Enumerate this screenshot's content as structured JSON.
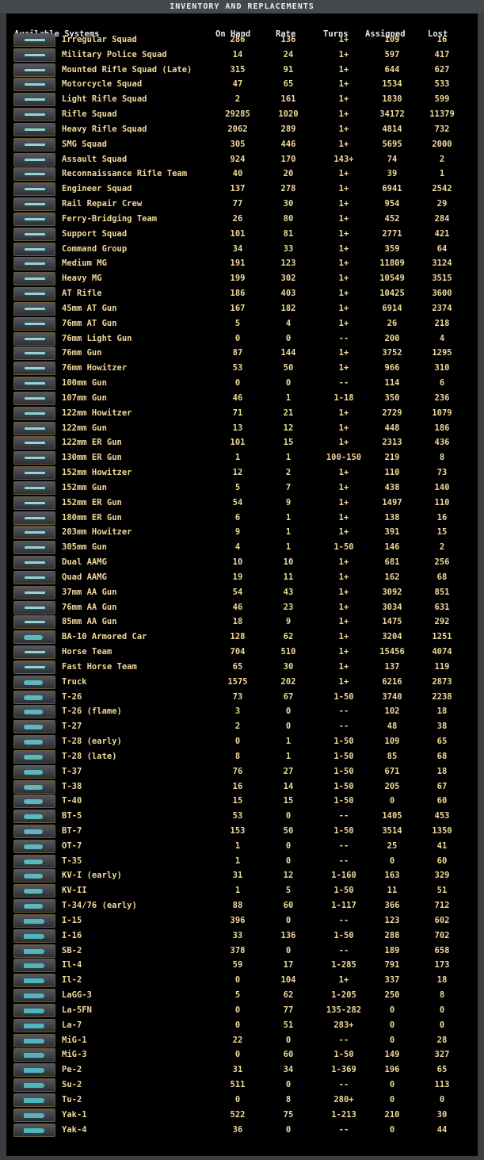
{
  "title": "INVENTORY AND REPLACEMENTS",
  "headers": {
    "name": "Available Systems",
    "on_hand": "On Hand",
    "rate": "Rate",
    "turns": "Turns",
    "assigned": "Assigned",
    "lost": "Lost"
  },
  "rows": [
    [
      "Irregular Squad",
      "286",
      "136",
      "1+",
      "109",
      "16",
      "rifle"
    ],
    [
      "Military Police Squad",
      "14",
      "24",
      "1+",
      "597",
      "417",
      "rifle"
    ],
    [
      "Mounted Rifle Squad (Late)",
      "315",
      "91",
      "1+",
      "644",
      "627",
      "rifle"
    ],
    [
      "Motorcycle Squad",
      "47",
      "65",
      "1+",
      "1534",
      "533",
      "rifle"
    ],
    [
      "Light Rifle Squad",
      "2",
      "161",
      "1+",
      "1830",
      "599",
      "rifle"
    ],
    [
      "Rifle Squad",
      "29285",
      "1020",
      "1+",
      "34172",
      "11379",
      "rifle"
    ],
    [
      "Heavy Rifle Squad",
      "2062",
      "289",
      "1+",
      "4814",
      "732",
      "rifle"
    ],
    [
      "SMG Squad",
      "305",
      "446",
      "1+",
      "5695",
      "2000",
      "rifle"
    ],
    [
      "Assault Squad",
      "924",
      "170",
      "143+",
      "74",
      "2",
      "rifle"
    ],
    [
      "Reconnaissance Rifle Team",
      "40",
      "20",
      "1+",
      "39",
      "1",
      "rifle"
    ],
    [
      "Engineer Squad",
      "137",
      "278",
      "1+",
      "6941",
      "2542",
      "rifle"
    ],
    [
      "Rail Repair Crew",
      "77",
      "30",
      "1+",
      "954",
      "29",
      "rifle"
    ],
    [
      "Ferry-Bridging Team",
      "26",
      "80",
      "1+",
      "452",
      "284",
      "rifle"
    ],
    [
      "Support Squad",
      "101",
      "81",
      "1+",
      "2771",
      "421",
      "rifle"
    ],
    [
      "Command Group",
      "34",
      "33",
      "1+",
      "359",
      "64",
      "rifle"
    ],
    [
      "Medium MG",
      "191",
      "123",
      "1+",
      "11809",
      "3124",
      "rifle"
    ],
    [
      "Heavy MG",
      "199",
      "302",
      "1+",
      "10549",
      "3515",
      "rifle"
    ],
    [
      "AT Rifle",
      "186",
      "403",
      "1+",
      "10425",
      "3600",
      "rifle"
    ],
    [
      "45mm AT Gun",
      "167",
      "182",
      "1+",
      "6914",
      "2374",
      "gun"
    ],
    [
      "76mm AT Gun",
      "5",
      "4",
      "1+",
      "26",
      "218",
      "gun"
    ],
    [
      "76mm Light Gun",
      "0",
      "0",
      "--",
      "200",
      "4",
      "gun"
    ],
    [
      "76mm Gun",
      "87",
      "144",
      "1+",
      "3752",
      "1295",
      "gun"
    ],
    [
      "76mm Howitzer",
      "53",
      "50",
      "1+",
      "966",
      "310",
      "gun"
    ],
    [
      "100mm Gun",
      "0",
      "0",
      "--",
      "114",
      "6",
      "gun"
    ],
    [
      "107mm Gun",
      "46",
      "1",
      "1-18",
      "350",
      "236",
      "gun"
    ],
    [
      "122mm Howitzer",
      "71",
      "21",
      "1+",
      "2729",
      "1079",
      "gun"
    ],
    [
      "122mm Gun",
      "13",
      "12",
      "1+",
      "448",
      "186",
      "gun"
    ],
    [
      "122mm ER Gun",
      "101",
      "15",
      "1+",
      "2313",
      "436",
      "gun"
    ],
    [
      "130mm ER Gun",
      "1",
      "1",
      "100-150",
      "219",
      "8",
      "gun"
    ],
    [
      "152mm Howitzer",
      "12",
      "2",
      "1+",
      "110",
      "73",
      "gun"
    ],
    [
      "152mm Gun",
      "5",
      "7",
      "1+",
      "438",
      "140",
      "gun"
    ],
    [
      "152mm ER Gun",
      "54",
      "9",
      "1+",
      "1497",
      "110",
      "gun"
    ],
    [
      "180mm ER Gun",
      "6",
      "1",
      "1+",
      "138",
      "16",
      "gun"
    ],
    [
      "203mm Howitzer",
      "9",
      "1",
      "1+",
      "391",
      "15",
      "gun"
    ],
    [
      "305mm Gun",
      "4",
      "1",
      "1-50",
      "146",
      "2",
      "gun"
    ],
    [
      "Dual AAMG",
      "10",
      "10",
      "1+",
      "681",
      "256",
      "gun"
    ],
    [
      "Quad AAMG",
      "19",
      "11",
      "1+",
      "162",
      "68",
      "gun"
    ],
    [
      "37mm AA Gun",
      "54",
      "43",
      "1+",
      "3092",
      "851",
      "gun"
    ],
    [
      "76mm AA Gun",
      "46",
      "23",
      "1+",
      "3034",
      "631",
      "gun"
    ],
    [
      "85mm AA Gun",
      "18",
      "9",
      "1+",
      "1475",
      "292",
      "gun"
    ],
    [
      "BA-10 Armored Car",
      "128",
      "62",
      "1+",
      "3204",
      "1251",
      "tank"
    ],
    [
      "Horse Team",
      "704",
      "510",
      "1+",
      "15456",
      "4074",
      "gun"
    ],
    [
      "Fast Horse Team",
      "65",
      "30",
      "1+",
      "137",
      "119",
      "gun"
    ],
    [
      "Truck",
      "1575",
      "202",
      "1+",
      "6216",
      "2873",
      "tank"
    ],
    [
      "T-26",
      "73",
      "67",
      "1-50",
      "3740",
      "2238",
      "tank"
    ],
    [
      "T-26 (flame)",
      "3",
      "0",
      "--",
      "102",
      "18",
      "tank"
    ],
    [
      "T-27",
      "2",
      "0",
      "--",
      "48",
      "38",
      "tank"
    ],
    [
      "T-28 (early)",
      "0",
      "1",
      "1-50",
      "109",
      "65",
      "tank"
    ],
    [
      "T-28 (late)",
      "8",
      "1",
      "1-50",
      "85",
      "68",
      "tank"
    ],
    [
      "T-37",
      "76",
      "27",
      "1-50",
      "671",
      "18",
      "tank"
    ],
    [
      "T-38",
      "16",
      "14",
      "1-50",
      "205",
      "67",
      "tank"
    ],
    [
      "T-40",
      "15",
      "15",
      "1-50",
      "0",
      "60",
      "tank"
    ],
    [
      "BT-5",
      "53",
      "0",
      "--",
      "1405",
      "453",
      "tank"
    ],
    [
      "BT-7",
      "153",
      "50",
      "1-50",
      "3514",
      "1350",
      "tank"
    ],
    [
      "OT-7",
      "1",
      "0",
      "--",
      "25",
      "41",
      "tank"
    ],
    [
      "T-35",
      "1",
      "0",
      "--",
      "0",
      "60",
      "tank"
    ],
    [
      "KV-I (early)",
      "31",
      "12",
      "1-160",
      "163",
      "329",
      "tank"
    ],
    [
      "KV-II",
      "1",
      "5",
      "1-50",
      "11",
      "51",
      "tank"
    ],
    [
      "T-34/76 (early)",
      "88",
      "60",
      "1-117",
      "366",
      "712",
      "tank"
    ],
    [
      "I-15",
      "396",
      "0",
      "--",
      "123",
      "602",
      "air"
    ],
    [
      "I-16",
      "33",
      "136",
      "1-50",
      "288",
      "702",
      "air"
    ],
    [
      "SB-2",
      "378",
      "0",
      "--",
      "189",
      "658",
      "air"
    ],
    [
      "Il-4",
      "59",
      "17",
      "1-285",
      "791",
      "173",
      "air"
    ],
    [
      "Il-2",
      "0",
      "104",
      "1+",
      "337",
      "18",
      "air"
    ],
    [
      "LaGG-3",
      "5",
      "62",
      "1-205",
      "250",
      "8",
      "air"
    ],
    [
      "La-5FN",
      "0",
      "77",
      "135-282",
      "0",
      "0",
      "air"
    ],
    [
      "La-7",
      "0",
      "51",
      "283+",
      "0",
      "0",
      "air"
    ],
    [
      "MiG-1",
      "22",
      "0",
      "--",
      "0",
      "28",
      "air"
    ],
    [
      "MiG-3",
      "0",
      "60",
      "1-50",
      "149",
      "327",
      "air"
    ],
    [
      "Pe-2",
      "31",
      "34",
      "1-369",
      "196",
      "65",
      "air"
    ],
    [
      "Su-2",
      "511",
      "0",
      "--",
      "0",
      "113",
      "air"
    ],
    [
      "Tu-2",
      "0",
      "8",
      "280+",
      "0",
      "0",
      "air"
    ],
    [
      "Yak-1",
      "522",
      "75",
      "1-213",
      "210",
      "30",
      "air"
    ],
    [
      "Yak-4",
      "36",
      "0",
      "--",
      "0",
      "44",
      "air"
    ]
  ]
}
